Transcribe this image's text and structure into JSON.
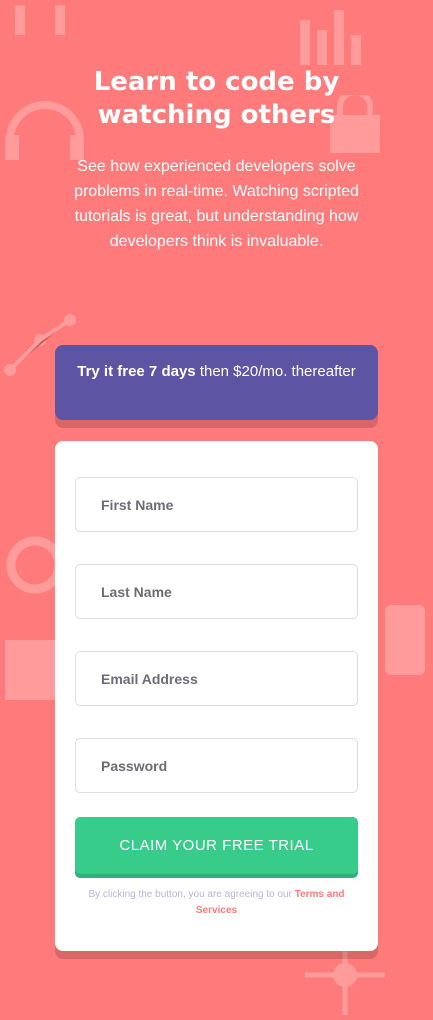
{
  "hero": {
    "title_line1": "Learn to code by",
    "title_line2": "watching others",
    "description": "See how experienced developers solve problems in real-time. Watching scripted tutorials is great, but understanding how developers think is invaluable."
  },
  "promo": {
    "bold_text": "Try it free 7 days",
    "rest_text": "then $20/mo. thereafter"
  },
  "form": {
    "first_name_placeholder": "First Name",
    "last_name_placeholder": "Last Name",
    "email_placeholder": "Email Address",
    "password_placeholder": "Password",
    "submit_label": "CLAIM YOUR FREE TRIAL",
    "legal_prefix": "By clicking the button, you are agreeing to our",
    "legal_link": "Terms and Services"
  },
  "colors": {
    "background": "#ff7a7a",
    "promo": "#5e54a4",
    "cta": "#38cc8b"
  }
}
